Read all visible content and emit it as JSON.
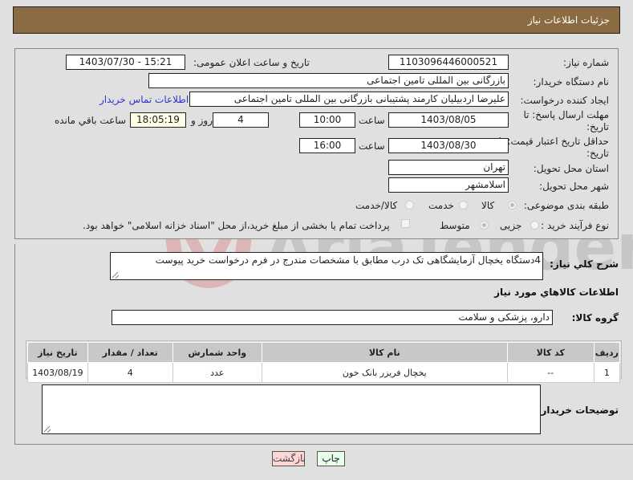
{
  "header": {
    "title": "جزئیات اطلاعات نیاز"
  },
  "fields": {
    "need_number": {
      "label": "شماره نیاز:",
      "value": "1103096446000521"
    },
    "announce_datetime": {
      "label": "تاریخ و ساعت اعلان عمومی:",
      "value": "1403/07/30 - 15:21"
    },
    "buyer_org": {
      "label": "نام دستگاه خریدار:",
      "value": "بازرگانی بین المللی تامین اجتماعی"
    },
    "requester": {
      "label": "ایجاد کننده درخواست:",
      "value": "علیرضا اردبیلیان کارمند پشتیبانی بازرگانی بین المللی تامین اجتماعی",
      "contact_link": "اطلاعات تماس خریدار"
    },
    "reply_deadline": {
      "label": "مهلت ارسال پاسخ: تا تاریخ:",
      "date": "1403/08/05",
      "time_label": "ساعت",
      "time": "10:00",
      "days": "4",
      "days_label": "روز و",
      "remaining_time": "18:05:19",
      "remaining_label": "ساعت باقي مانده"
    },
    "price_validity": {
      "label": "حداقل تاریخ اعتبار قیمت: تا تاریخ:",
      "date": "1403/08/30",
      "time_label": "ساعت",
      "time": "16:00"
    },
    "delivery_province": {
      "label": "استان محل تحویل:",
      "value": "تهران"
    },
    "delivery_city": {
      "label": "شهر محل تحویل:",
      "value": "اسلامشهر"
    },
    "category": {
      "label": "طبقه بندی موضوعی:",
      "options": [
        "کالا",
        "خدمت",
        "کالا/خدمت"
      ],
      "selected": "کالا"
    },
    "purchase_type": {
      "label": "نوع فرآیند خرید :",
      "options": [
        "جزیی",
        "متوسط"
      ],
      "selected": "متوسط",
      "payment_checkbox_label": "پرداخت تمام یا بخشی از مبلغ خرید،از محل \"اسناد خزانه اسلامی\" خواهد بود."
    }
  },
  "description": {
    "label": "شرح کلي نياز:",
    "value": "4دستگاه یخچال آزمایشگاهی تک درب مطابق با مشخصات مندرج در فرم درخواست خرید پیوست"
  },
  "goods_section": {
    "title": "اطلاعات کالاهاي مورد نياز",
    "group_label": "گروه کالا:",
    "group_value": "دارو، پزشکی و سلامت",
    "table": {
      "headers": [
        "رديف",
        "کد کالا",
        "نام کالا",
        "واحد شمارش",
        "تعداد / مقدار",
        "تاریخ نیاز"
      ],
      "rows": [
        [
          "1",
          "--",
          "یخچال فریزر بانک خون",
          "عدد",
          "4",
          "1403/08/19"
        ]
      ]
    }
  },
  "buyer_notes": {
    "label": "توضیحات خریدار:",
    "value": ""
  },
  "buttons": {
    "print": "چاپ",
    "back": "بازگشت"
  },
  "watermark": {
    "text": "AriaTender.neT"
  },
  "colors": {
    "header_bg": "#8b6b42",
    "link": "#3333cc",
    "back_bg": "#ffd6d6",
    "print_bg": "#eaffea"
  }
}
